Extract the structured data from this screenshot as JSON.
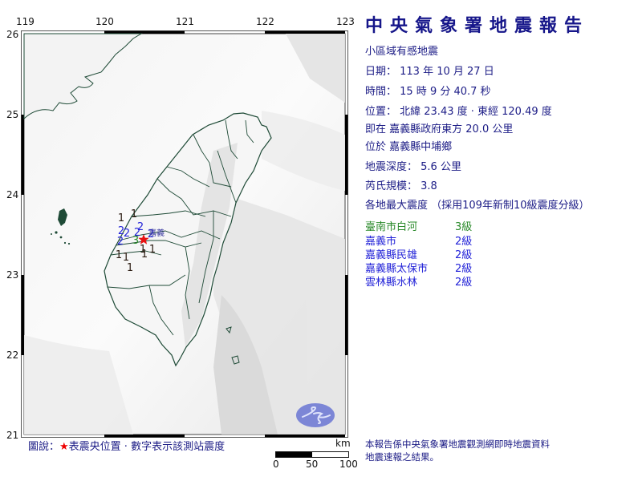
{
  "report": {
    "title": "中央氣象署地震報告",
    "category": "小區域有感地震",
    "date": "日期： 113 年 10 月 27 日",
    "time": "時間： 15 時 9 分 40.7 秒",
    "location": "位置： 北緯 23.43 度 · 東經 120.49 度",
    "relative": "即在 嘉義縣政府東方 20.0 公里",
    "township": "位於 嘉義縣中埔鄉",
    "depth": "地震深度： 5.6 公里",
    "magnitude": "芮氏規模： 3.8",
    "intensity_header": "各地最大震度 （採用109年新制10級震度分級）"
  },
  "stations": [
    {
      "name": "臺南市白河",
      "level": "3級",
      "color": "#2a8a2a"
    },
    {
      "name": "嘉義市",
      "level": "2級",
      "color": "#2323d8"
    },
    {
      "name": "嘉義縣民雄",
      "level": "2級",
      "color": "#2323d8"
    },
    {
      "name": "嘉義縣太保市",
      "level": "2級",
      "color": "#2323d8"
    },
    {
      "name": "雲林縣水林",
      "level": "2級",
      "color": "#2323d8"
    }
  ],
  "footer": {
    "line1": "本報告係中央氣象署地震觀測網即時地震資料",
    "line2": "地震速報之結果。"
  },
  "map": {
    "lon_ticks": [
      "119",
      "120",
      "121",
      "122",
      "123"
    ],
    "lat_ticks": [
      "26",
      "25",
      "24",
      "23",
      "22",
      "21"
    ],
    "epicenter": {
      "lat": 23.43,
      "lon": 120.49,
      "icon": "red-star"
    },
    "city_label": "嘉義",
    "station_marks": [
      {
        "v": "1",
        "lat": 23.66,
        "lon": 120.21
      },
      {
        "v": "1",
        "lat": 23.71,
        "lon": 120.37
      },
      {
        "v": "2",
        "lat": 23.5,
        "lon": 120.21
      },
      {
        "v": "2",
        "lat": 23.47,
        "lon": 120.28
      },
      {
        "v": "2",
        "lat": 23.55,
        "lon": 120.45
      },
      {
        "v": "2",
        "lat": 23.48,
        "lon": 120.41
      },
      {
        "v": "2",
        "lat": 23.46,
        "lon": 120.58
      },
      {
        "v": "2",
        "lat": 23.37,
        "lon": 120.2
      },
      {
        "v": "3",
        "lat": 23.38,
        "lon": 120.39
      },
      {
        "v": "1",
        "lat": 23.27,
        "lon": 120.48
      },
      {
        "v": "1",
        "lat": 23.27,
        "lon": 120.6
      },
      {
        "v": "1",
        "lat": 23.21,
        "lon": 120.5
      },
      {
        "v": "1",
        "lat": 23.2,
        "lon": 120.18
      },
      {
        "v": "1",
        "lat": 23.17,
        "lon": 120.27
      },
      {
        "v": "1",
        "lat": 23.04,
        "lon": 120.32
      }
    ],
    "logo": "cwa-logo-icon"
  },
  "legend": {
    "prefix": "圖說：",
    "star": "★",
    "text": "表震央位置 · 數字表示該測站震度"
  },
  "scale_bar": {
    "unit": "km",
    "labels": [
      "0",
      "50",
      "100"
    ]
  }
}
